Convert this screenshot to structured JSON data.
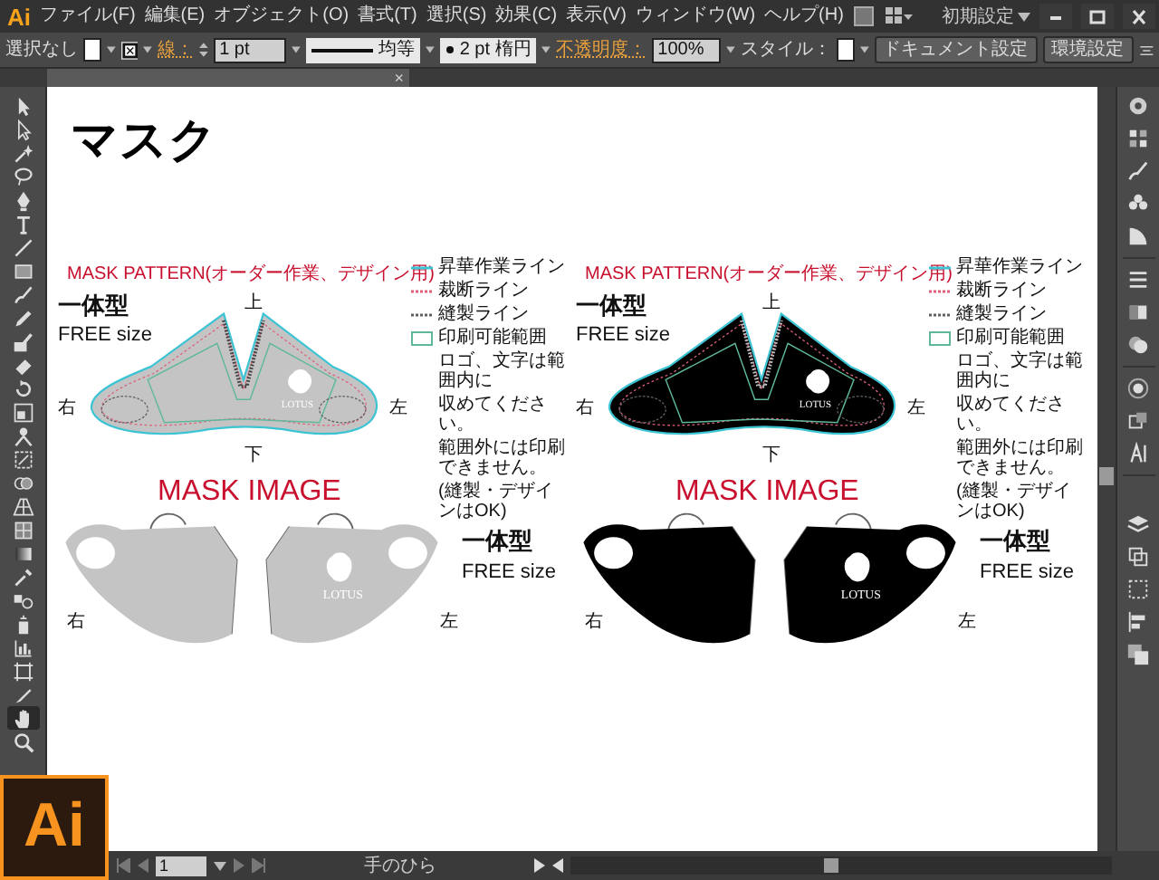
{
  "app": {
    "logo": "Ai"
  },
  "menu": [
    "ファイル(F)",
    "編集(E)",
    "オブジェクト(O)",
    "書式(T)",
    "選択(S)",
    "効果(C)",
    "表示(V)",
    "ウィンドウ(W)",
    "ヘルプ(H)"
  ],
  "workspace": "初期設定",
  "control_bar": {
    "selection": "選択なし",
    "stroke_label": "線：",
    "stroke_weight": "1 pt",
    "stroke_profile": "均等",
    "brush": "2 pt 楕円",
    "opacity_label": "不透明度：",
    "opacity": "100%",
    "style_label": "スタイル：",
    "buttons": [
      "ドキュメント設定",
      "環境設定"
    ]
  },
  "document_tab": {
    "close": "×"
  },
  "tools": [
    {
      "selected": false
    },
    {
      "selected": false
    },
    {
      "selected": false
    },
    {
      "selected": false
    },
    {
      "selected": false
    },
    {
      "selected": false
    },
    {
      "selected": false
    },
    {
      "selected": false
    },
    {
      "selected": false
    },
    {
      "selected": false
    },
    {
      "selected": false
    },
    {
      "selected": false
    },
    {
      "selected": false
    },
    {
      "selected": false
    },
    {
      "selected": false
    },
    {
      "selected": false
    },
    {
      "selected": false
    },
    {
      "selected": false
    },
    {
      "selected": false
    },
    {
      "selected": false
    },
    {
      "selected": false
    },
    {
      "selected": false
    },
    {
      "selected": false
    },
    {
      "selected": false
    },
    {
      "selected": false
    },
    {
      "selected": false
    },
    {
      "selected": true
    },
    {
      "selected": false
    }
  ],
  "artboard": {
    "title": "マスク",
    "panels": [
      {
        "color": "#c4c4c4",
        "pattern_title": "MASK PATTERN(オーダー作業、デザイン用)",
        "type": "一体型",
        "size": "FREE size",
        "directions": {
          "top": "上",
          "right": "右",
          "left": "左",
          "bottom": "下"
        },
        "logo": "LOTUS",
        "legend": [
          {
            "kind": "solid",
            "color": "#3cc4d4",
            "label": "昇華作業ライン"
          },
          {
            "kind": "dotted",
            "color": "#e0607a",
            "label": "裁断ライン"
          },
          {
            "kind": "dotted",
            "color": "#606060",
            "label": "縫製ライン"
          },
          {
            "kind": "area",
            "color": "#5fb89a",
            "label": "印刷可能範囲",
            "note": [
              "ロゴ、文字は範囲内に",
              "収めてください。",
              "範囲外には印刷できません。",
              "(縫製・デザインはOK)"
            ]
          }
        ],
        "image_title": "MASK IMAGE",
        "image_type": "一体型",
        "image_size": "FREE size",
        "image_directions": {
          "right": "右",
          "left": "左"
        },
        "image_logo": "LOTUS"
      },
      {
        "color": "#000000",
        "pattern_title": "MASK PATTERN(オーダー作業、デザイン用)",
        "type": "一体型",
        "size": "FREE size",
        "directions": {
          "top": "上",
          "right": "右",
          "left": "左",
          "bottom": "下"
        },
        "logo": "LOTUS",
        "legend": [
          {
            "kind": "solid",
            "color": "#3cc4d4",
            "label": "昇華作業ライン"
          },
          {
            "kind": "dotted",
            "color": "#e0607a",
            "label": "裁断ライン"
          },
          {
            "kind": "dotted",
            "color": "#606060",
            "label": "縫製ライン"
          },
          {
            "kind": "area",
            "color": "#5fb89a",
            "label": "印刷可能範囲",
            "note": [
              "ロゴ、文字は範囲内に",
              "収めてください。",
              "範囲外には印刷できません。",
              "(縫製・デザインはOK)"
            ]
          }
        ],
        "image_title": "MASK IMAGE",
        "image_type": "一体型",
        "image_size": "FREE size",
        "image_directions": {
          "right": "右",
          "left": "左"
        },
        "image_logo": "LOTUS"
      }
    ]
  },
  "status_bar": {
    "page": "1",
    "tool": "手のひら"
  },
  "corner_logo": "Ai"
}
